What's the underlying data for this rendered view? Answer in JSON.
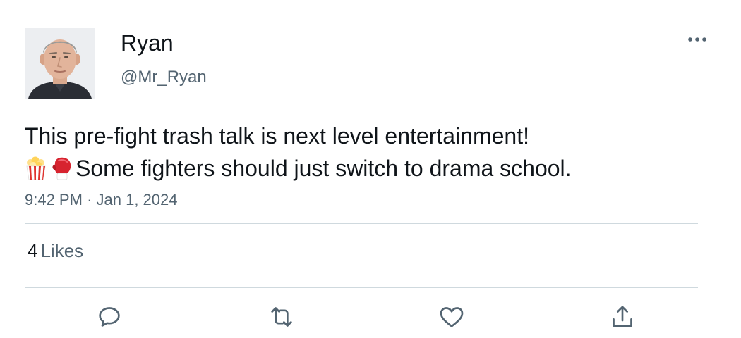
{
  "user": {
    "name": "Ryan",
    "handle": "@Mr_Ryan"
  },
  "tweet": {
    "line1": "This pre-fight trash talk is next level entertainment!",
    "emoji_icons": [
      "popcorn-icon",
      "boxing-glove-icon"
    ],
    "line2": "Some fighters should just switch to drama school.",
    "time": "9:42 PM",
    "separator": "·",
    "date": "Jan 1, 2024"
  },
  "stats": {
    "likes_count": "4",
    "likes_label": "Likes"
  },
  "actions": [
    "reply-icon",
    "retweet-icon",
    "like-icon",
    "share-icon"
  ],
  "colors": {
    "text": "#0f1419",
    "secondary": "#536471",
    "divider": "#cfd9de",
    "icon": "#536471"
  }
}
